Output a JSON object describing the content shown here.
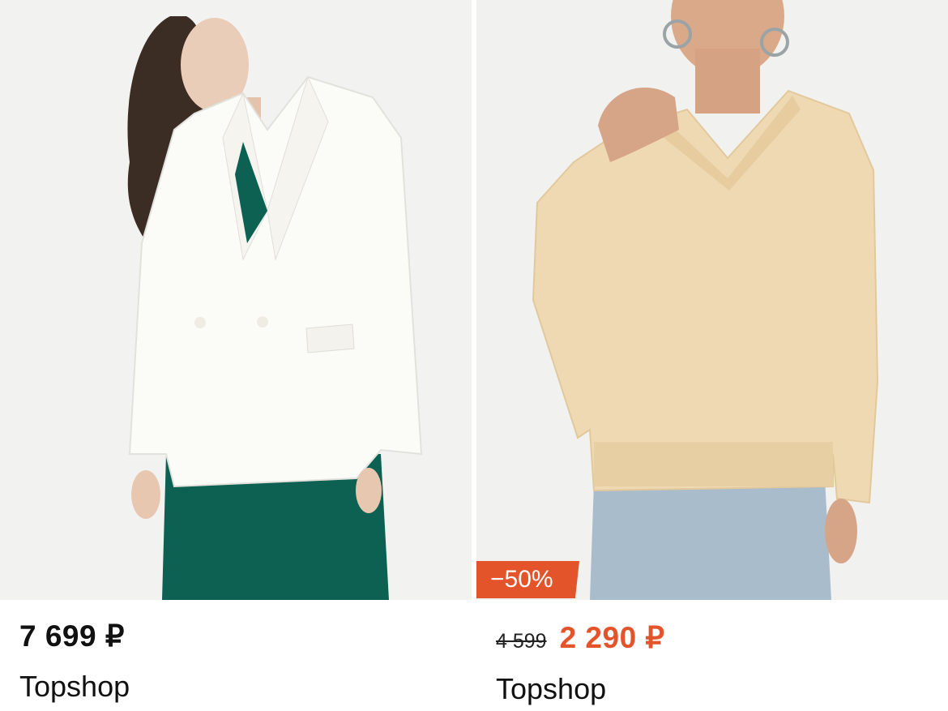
{
  "products": [
    {
      "image_alt": "White double-breasted blazer",
      "price": "7 699 ₽",
      "brand": "Topshop"
    },
    {
      "image_alt": "Beige V-neck sweater",
      "discount_badge": "−50%",
      "old_price": "4 599",
      "sale_price": "2 290 ₽",
      "brand": "Topshop"
    }
  ],
  "colors": {
    "accent": "#e4542b",
    "text": "#111111",
    "photo_bg": "#f1f1f0"
  }
}
